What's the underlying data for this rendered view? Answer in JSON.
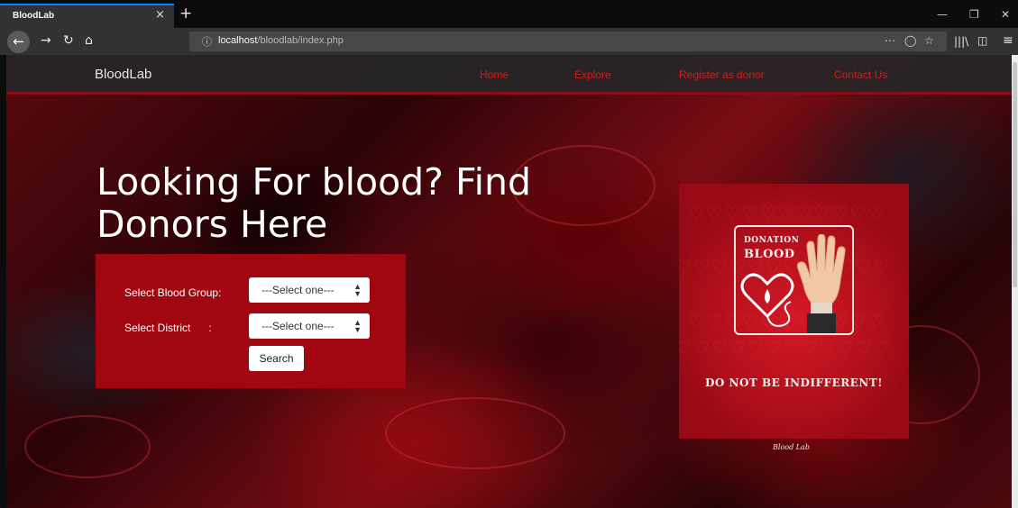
{
  "browser": {
    "tab_title": "BloodLab",
    "tab_close": "×",
    "new_tab": "+",
    "url_host": "localhost",
    "url_path": "/bloodlab/index.php",
    "url_info_icon": "ⓘ",
    "icons": [
      "back-arrow-icon",
      "forward-arrow-icon",
      "reload-icon",
      "home-icon",
      "info-icon",
      "page-actions-icon",
      "pocket-icon",
      "bookmark-star-icon",
      "library-icon",
      "sidebar-icon",
      "menu-icon",
      "minimize-icon",
      "restore-icon",
      "close-window-icon"
    ]
  },
  "site": {
    "brand": "BloodLab",
    "nav": {
      "home": "Home",
      "explore": "Explore",
      "register": "Register as donor",
      "contact": "Contact Us"
    },
    "link_color": "#d41c1c"
  },
  "hero": {
    "title": "Looking For blood? Find Donors Here"
  },
  "search": {
    "blood_group_label": "Select Blood Group:",
    "blood_group_value": "---Select one---",
    "district_label": "Select District      :",
    "district_value": "---Select one---",
    "button_label": "Search",
    "panel_color": "#a10710"
  },
  "poster": {
    "donation": "DONATION",
    "blood": "BLOOD",
    "slogan": "DO NOT BE INDIFFERENT!",
    "caption": "Blood Lab"
  }
}
